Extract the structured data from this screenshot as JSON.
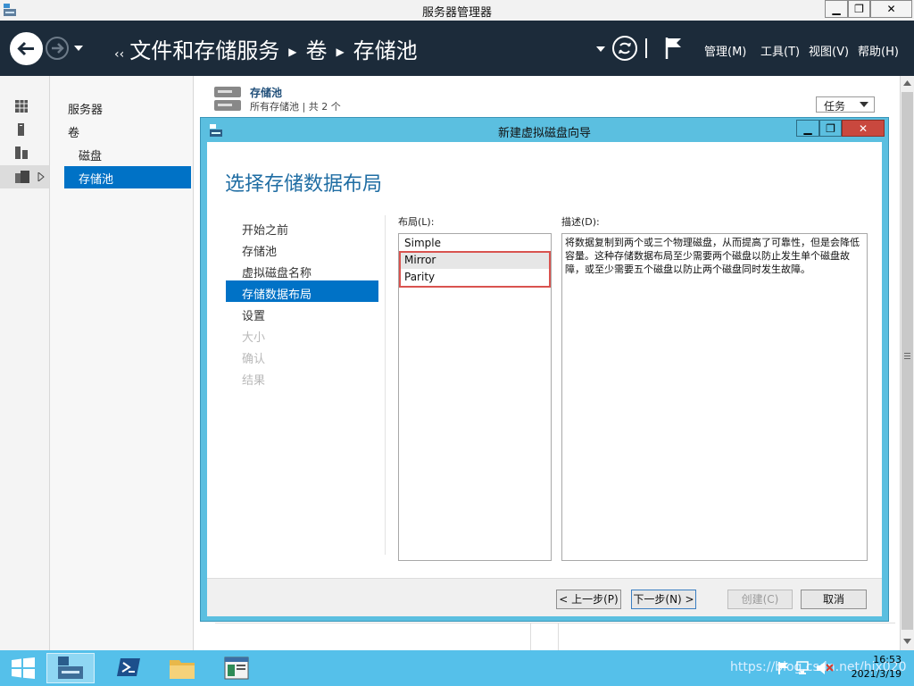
{
  "window": {
    "title": "服务器管理器"
  },
  "nav": {
    "breadcrumb": [
      "文件和存储服务",
      "卷",
      "存储池"
    ],
    "menus": [
      "管理(M)",
      "工具(T)",
      "视图(V)",
      "帮助(H)"
    ]
  },
  "sidebar": {
    "items": [
      "服务器",
      "卷",
      "磁盘",
      "存储池"
    ]
  },
  "header": {
    "title": "存储池",
    "subtitle": "所有存储池 | 共 2 个",
    "tasks_label": "任务"
  },
  "dialog": {
    "title": "新建虚拟磁盘向导",
    "heading": "选择存储数据布局",
    "steps": [
      "开始之前",
      "存储池",
      "虚拟磁盘名称",
      "存储数据布局",
      "设置",
      "大小",
      "确认",
      "结果"
    ],
    "layout_label": "布局(L):",
    "layouts": [
      "Simple",
      "Mirror",
      "Parity"
    ],
    "description_label": "描述(D):",
    "description": "将数据复制到两个或三个物理磁盘，从而提高了可靠性，但是会降低容量。这种存储数据布局至少需要两个磁盘以防止发生单个磁盘故障，或至少需要五个磁盘以防止两个磁盘同时发生故障。",
    "buttons": {
      "prev": "< 上一步(P)",
      "next": "下一步(N) >",
      "create": "创建(C)",
      "cancel": "取消"
    }
  },
  "taskbar": {
    "time": "16:53",
    "date": "2021/3/19",
    "watermark": "https://blog.csdn.net/hjx020"
  },
  "colors": {
    "accent": "#0072c6",
    "dialog_frame": "#5bbfe0",
    "taskbar": "#55c0ea",
    "highlight_box": "#d9534f"
  }
}
